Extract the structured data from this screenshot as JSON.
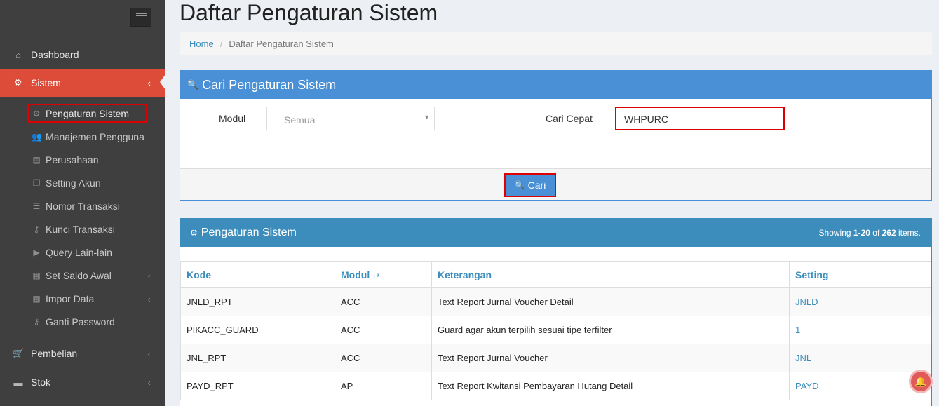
{
  "sidebar": {
    "menu": [
      {
        "label": "Dashboard",
        "icon": "home-icon",
        "glyph": "⌂"
      },
      {
        "label": "Sistem",
        "icon": "gears-icon",
        "glyph": "⚙",
        "chevron": "‹"
      },
      {
        "label": "Pembelian",
        "icon": "cart-icon",
        "glyph": "🛒",
        "chevron": "‹"
      },
      {
        "label": "Stok",
        "icon": "box-icon",
        "glyph": "▬",
        "chevron": "‹"
      }
    ],
    "submenu": [
      {
        "label": "Pengaturan Sistem",
        "icon": "gear-icon",
        "glyph": "⚙"
      },
      {
        "label": "Manajemen Pengguna",
        "icon": "users-icon",
        "glyph": "👥"
      },
      {
        "label": "Perusahaan",
        "icon": "building-icon",
        "glyph": "▤"
      },
      {
        "label": "Setting Akun",
        "icon": "copy-icon",
        "glyph": "❐"
      },
      {
        "label": "Nomor Transaksi",
        "icon": "list-icon",
        "glyph": "☰"
      },
      {
        "label": "Kunci Transaksi",
        "icon": "key-icon",
        "glyph": "⚷"
      },
      {
        "label": "Query Lain-lain",
        "icon": "play-icon",
        "glyph": "▶"
      },
      {
        "label": "Set Saldo Awal",
        "icon": "calculator-icon",
        "glyph": "▦",
        "chevron": "‹"
      },
      {
        "label": "Impor Data",
        "icon": "table-icon",
        "glyph": "▦",
        "chevron": "‹"
      },
      {
        "label": "Ganti Password",
        "icon": "key-icon",
        "glyph": "⚷"
      }
    ]
  },
  "page": {
    "title": "Daftar Pengaturan Sistem",
    "breadcrumb": {
      "home": "Home",
      "separator": "/",
      "current": "Daftar Pengaturan Sistem"
    }
  },
  "search": {
    "title": "Cari Pengaturan Sistem",
    "modul_label": "Modul",
    "modul_value": "Semua",
    "cari_cepat_label": "Cari Cepat",
    "cari_cepat_value": "WHPURC",
    "button_label": "Cari"
  },
  "list": {
    "title": "Pengaturan Sistem",
    "summary_prefix": "Showing ",
    "summary_range": "1-20",
    "summary_mid": " of ",
    "summary_total": "262",
    "summary_suffix": " items.",
    "columns": [
      "Kode",
      "Modul",
      "Keterangan",
      "Setting"
    ],
    "rows": [
      {
        "kode": "JNLD_RPT",
        "modul": "ACC",
        "keterangan": "Text Report Jurnal Voucher Detail",
        "setting": "JNLD"
      },
      {
        "kode": "PIKACC_GUARD",
        "modul": "ACC",
        "keterangan": "Guard agar akun terpilih sesuai tipe terfilter",
        "setting": "1"
      },
      {
        "kode": "JNL_RPT",
        "modul": "ACC",
        "keterangan": "Text Report Jurnal Voucher",
        "setting": "JNL"
      },
      {
        "kode": "PAYD_RPT",
        "modul": "AP",
        "keterangan": "Text Report Kwitansi Pembayaran Hutang Detail",
        "setting": "PAYD"
      }
    ]
  },
  "colors": {
    "sidebar_bg": "#3f3f3f",
    "active_menu": "#dd4b39",
    "panel_head": "#3c8dbc",
    "highlight": "#dd0000"
  }
}
